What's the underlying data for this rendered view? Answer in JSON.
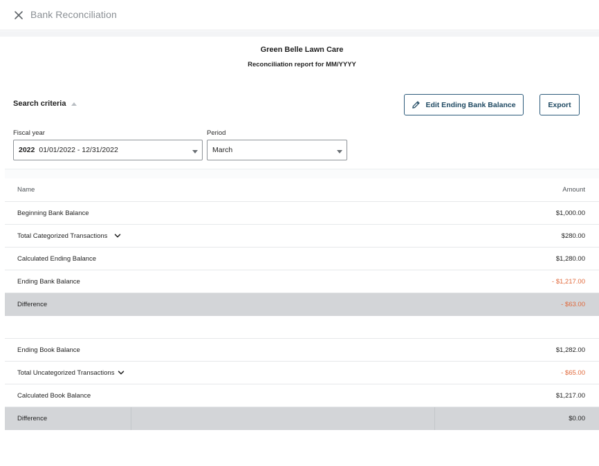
{
  "topbar": {
    "title": "Bank Reconciliation"
  },
  "report": {
    "company": "Green Belle Lawn Care",
    "subtitle": "Reconciliation report for MM/YYYY"
  },
  "search": {
    "label": "Search criteria",
    "edit_button": "Edit Ending Bank Balance",
    "export_button": "Export",
    "fiscal_year_label": "Fiscal year",
    "fiscal_year_value": "2022",
    "fiscal_year_range": "01/01/2022 - 12/31/2022",
    "period_label": "Period",
    "period_value": "March"
  },
  "table": {
    "headers": {
      "name": "Name",
      "amount": "Amount"
    },
    "bank_rows": [
      {
        "name": "Beginning Bank Balance",
        "amount": "$1,000.00"
      },
      {
        "name": "Total Categorized Transactions",
        "amount": "$280.00"
      },
      {
        "name": "Calculated Ending Balance",
        "amount": "$1,280.00"
      },
      {
        "name": "Ending Bank Balance",
        "amount": "- $1,217.00"
      }
    ],
    "bank_difference": {
      "name": "Difference",
      "amount": "- $63.00"
    },
    "book_rows": [
      {
        "name": "Ending Book Balance",
        "amount": "$1,282.00"
      },
      {
        "name": "Total Uncategorized Transactions",
        "amount": "- $65.00"
      },
      {
        "name": "Calculated Book Balance",
        "amount": "$1,217.00"
      }
    ],
    "book_difference": {
      "name": "Difference",
      "amount": "$0.00"
    }
  },
  "colors": {
    "negative": "#e0683a",
    "accent": "#204a63",
    "difference_row": "#d3d5d8"
  }
}
